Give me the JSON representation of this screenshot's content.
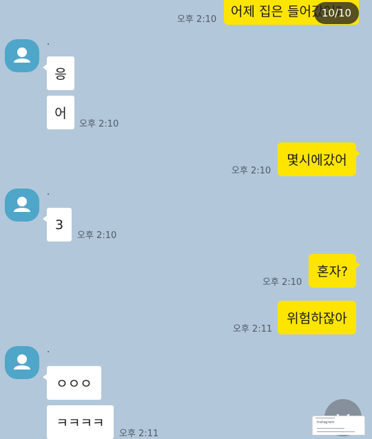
{
  "page_indicator": "10/10",
  "colors": {
    "background": "#b2c7da",
    "my_bubble": "#fee500",
    "other_bubble": "#ffffff",
    "avatar": "#4fa6c9"
  },
  "messages": [
    {
      "from": "me",
      "text": "어제 집은 들어갔어?",
      "time": "오후 2:10"
    },
    {
      "from": "other",
      "sender": "·",
      "text": "응",
      "time": ""
    },
    {
      "from": "other",
      "text": "어",
      "time": "오후 2:10"
    },
    {
      "from": "me",
      "text": "몇시에갔어",
      "time": "오후 2:10"
    },
    {
      "from": "other",
      "sender": "·",
      "text": "3",
      "time": "오후 2:10"
    },
    {
      "from": "me",
      "text": "혼자?",
      "time": "오후 2:10"
    },
    {
      "from": "me",
      "text": "위험하잖아",
      "time": "오후 2:11"
    },
    {
      "from": "other",
      "sender": "·",
      "text": "ㅇㅇㅇ",
      "time": ""
    },
    {
      "from": "other",
      "text": "ㅋㅋㅋㅋ",
      "time": "오후 2:11"
    }
  ],
  "icons": {
    "avatar": "default-profile-icon",
    "scroll_button": "chevron-down-icon"
  },
  "thumbnail": {
    "text": "Instagram"
  }
}
